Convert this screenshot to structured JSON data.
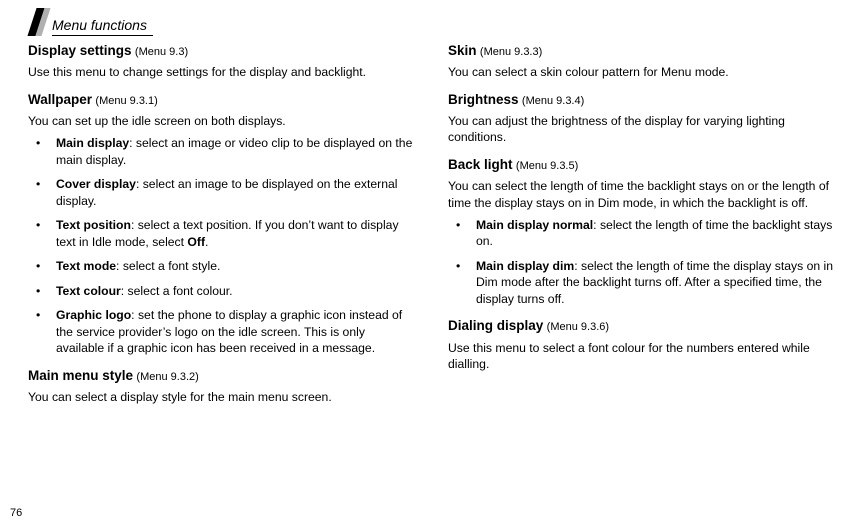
{
  "page_number": "76",
  "header": {
    "title": "Menu functions"
  },
  "left": {
    "display_settings": {
      "title": "Display settings",
      "ref": "(Menu 9.3)",
      "intro": "Use this menu to change settings for the display and backlight."
    },
    "wallpaper": {
      "title": "Wallpaper",
      "ref": "(Menu 9.3.1)",
      "intro": "You can set up the idle screen on both displays.",
      "items": [
        {
          "label": "Main display",
          "text": ": select an image or video clip to be displayed on the main display."
        },
        {
          "label": "Cover display",
          "text": ": select an image to be displayed on the external display."
        },
        {
          "label": "Text position",
          "text_a": ": select a text position. If you don’t want to display text in Idle mode, select ",
          "off": "Off",
          "text_b": "."
        },
        {
          "label": "Text mode",
          "text": ": select a font style."
        },
        {
          "label": "Text colour",
          "text": ": select a font colour."
        },
        {
          "label": "Graphic logo",
          "text": ": set the phone to display a graphic icon instead of the service provider’s logo on the idle screen. This is only available if a graphic icon has been received in a message."
        }
      ]
    },
    "main_menu_style": {
      "title": "Main menu style",
      "ref": "(Menu 9.3.2)",
      "intro": "You can select a display style for the main menu screen."
    }
  },
  "right": {
    "skin": {
      "title": "Skin",
      "ref": "(Menu 9.3.3)",
      "intro": "You can select a skin colour pattern for Menu mode."
    },
    "brightness": {
      "title": "Brightness",
      "ref": "(Menu 9.3.4)",
      "intro": "You can adjust the brightness of the display for varying lighting conditions."
    },
    "backlight": {
      "title": "Back light",
      "ref": "(Menu 9.3.5)",
      "intro": "You can select the length of time the backlight stays on or the length of time the display stays on in Dim mode, in which the backlight is off.",
      "items": [
        {
          "label": "Main display normal",
          "text": ": select the length of time the backlight stays on."
        },
        {
          "label": "Main display dim",
          "text": ": select the length of time the display stays on in Dim mode after the backlight turns off. After a specified time, the display turns off."
        }
      ]
    },
    "dialing": {
      "title": "Dialing display",
      "ref": "(Menu 9.3.6)",
      "intro": "Use this menu to select a font colour for the numbers entered while dialling."
    }
  }
}
